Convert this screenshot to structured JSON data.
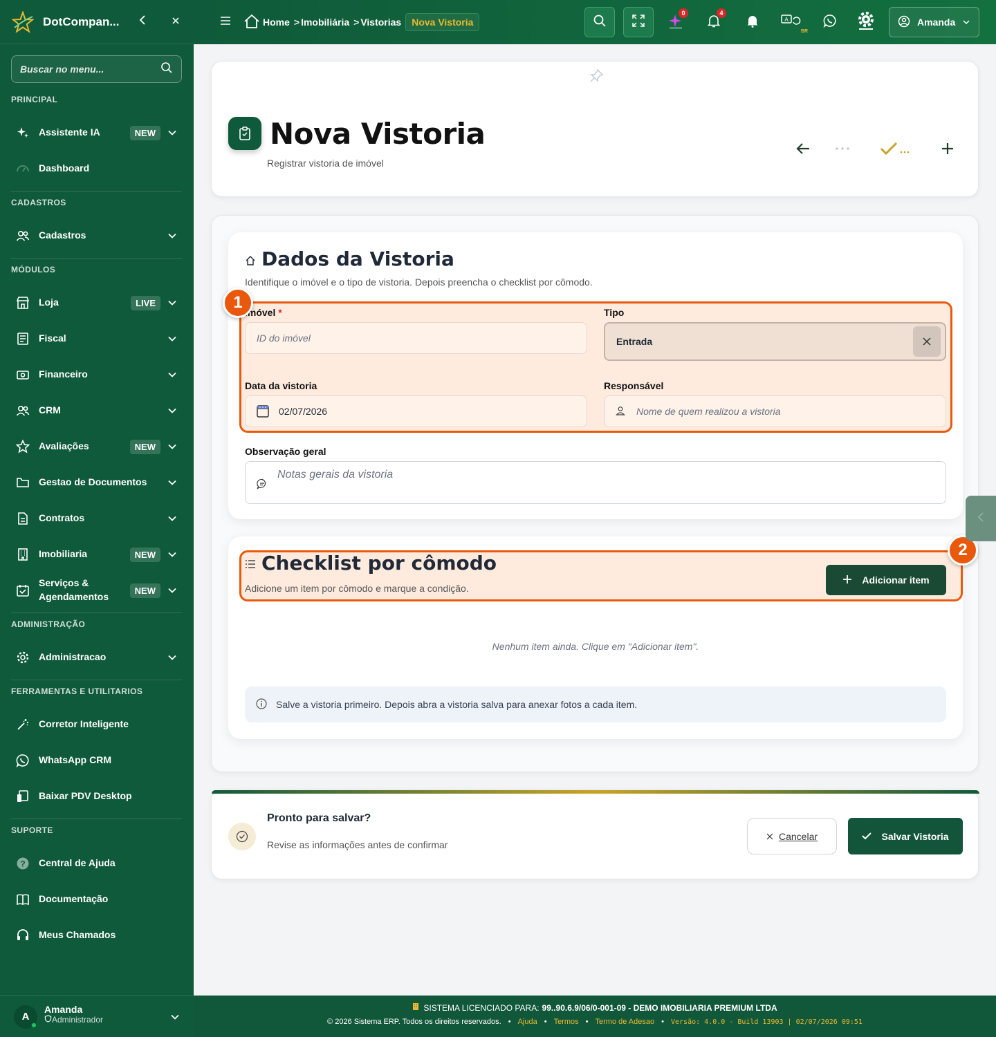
{
  "sidebar": {
    "brand": "DotCompan...",
    "search_placeholder": "Buscar no menu...",
    "sections": {
      "principal": "PRINCIPAL",
      "cadastros": "CADASTROS",
      "modulos": "MÓDULOS",
      "admin": "ADMINISTRAÇÃO",
      "ferramentas": "FERRAMENTAS E UTILITARIOS",
      "suporte": "SUPORTE"
    },
    "items": {
      "assistente": {
        "label": "Assistente IA",
        "badge": "NEW"
      },
      "dashboard": {
        "label": "Dashboard"
      },
      "cadastros": {
        "label": "Cadastros"
      },
      "loja": {
        "label": "Loja",
        "badge": "LIVE"
      },
      "fiscal": {
        "label": "Fiscal"
      },
      "financeiro": {
        "label": "Financeiro"
      },
      "crm": {
        "label": "CRM"
      },
      "avaliacoes": {
        "label": "Avaliações",
        "badge": "NEW"
      },
      "gestao": {
        "label": "Gestao de Documentos"
      },
      "contratos": {
        "label": "Contratos"
      },
      "imobiliaria": {
        "label": "Imobiliaria",
        "badge": "NEW"
      },
      "servicos": {
        "label": "Serviços & Agendamentos",
        "badge": "NEW"
      },
      "administracao": {
        "label": "Administracao"
      },
      "corretor": {
        "label": "Corretor Inteligente"
      },
      "whatsapp": {
        "label": "WhatsApp CRM"
      },
      "pdv": {
        "label": "Baixar PDV Desktop"
      },
      "ajuda": {
        "label": "Central de Ajuda"
      },
      "docs": {
        "label": "Documentação"
      },
      "chamados": {
        "label": "Meus Chamados"
      }
    },
    "user": {
      "initial": "A",
      "name": "Amanda",
      "role": "Administrador"
    }
  },
  "topbar": {
    "breadcrumb": [
      "Home",
      "Imobiliária",
      "Vistorias"
    ],
    "breadcrumb_active": "Nova Vistoria",
    "ai_count": "0",
    "notif_count": "4",
    "lang": "BR",
    "user": "Amanda"
  },
  "header": {
    "title": "Nova Vistoria",
    "subtitle": "Registrar vistoria de imóvel"
  },
  "dados": {
    "title": "Dados da Vistoria",
    "desc": "Identifique o imóvel e o tipo de vistoria. Depois preencha o checklist por cômodo.",
    "imovel_label": "Imóvel",
    "imovel_required": "*",
    "imovel_placeholder": "ID do imóvel",
    "tipo_label": "Tipo",
    "tipo_value": "Entrada",
    "data_label": "Data da vistoria",
    "data_value": "02/07/2026",
    "responsavel_label": "Responsável",
    "responsavel_placeholder": "Nome de quem realizou a vistoria",
    "obs_label": "Observação geral",
    "obs_placeholder": "Notas gerais da vistoria"
  },
  "checklist": {
    "title": "Checklist por cômodo",
    "desc": "Adicione um item por cômodo e marque a condição.",
    "add_button": "Adicionar item",
    "empty": "Nenhum item ainda. Clique em \"Adicionar item\".",
    "info": "Salve a vistoria primeiro. Depois abra a vistoria salva para anexar fotos a cada item."
  },
  "markers": [
    "1",
    "2"
  ],
  "savebar": {
    "title": "Pronto para salvar?",
    "desc": "Revise as informações antes de confirmar",
    "cancel": "Cancelar",
    "save": "Salvar Vistoria"
  },
  "footer": {
    "license_prefix": "SISTEMA LICENCIADO PARA:",
    "license_value": "99..90.6.9/06/0-001-09 - DEMO IMOBILIARIA PREMIUM LTDA",
    "copyright": "© 2026 Sistema ERP. Todos os direitos reservados.",
    "links": [
      "Ajuda",
      "Termos",
      "Termo de Adesao"
    ],
    "version": "Versão: 4.0.0 - Build 13903 | 02/07/2026 09:51"
  },
  "colors": {
    "primary": "#0f5a3a",
    "accent": "#e8b931",
    "highlight": "#ea580c"
  }
}
